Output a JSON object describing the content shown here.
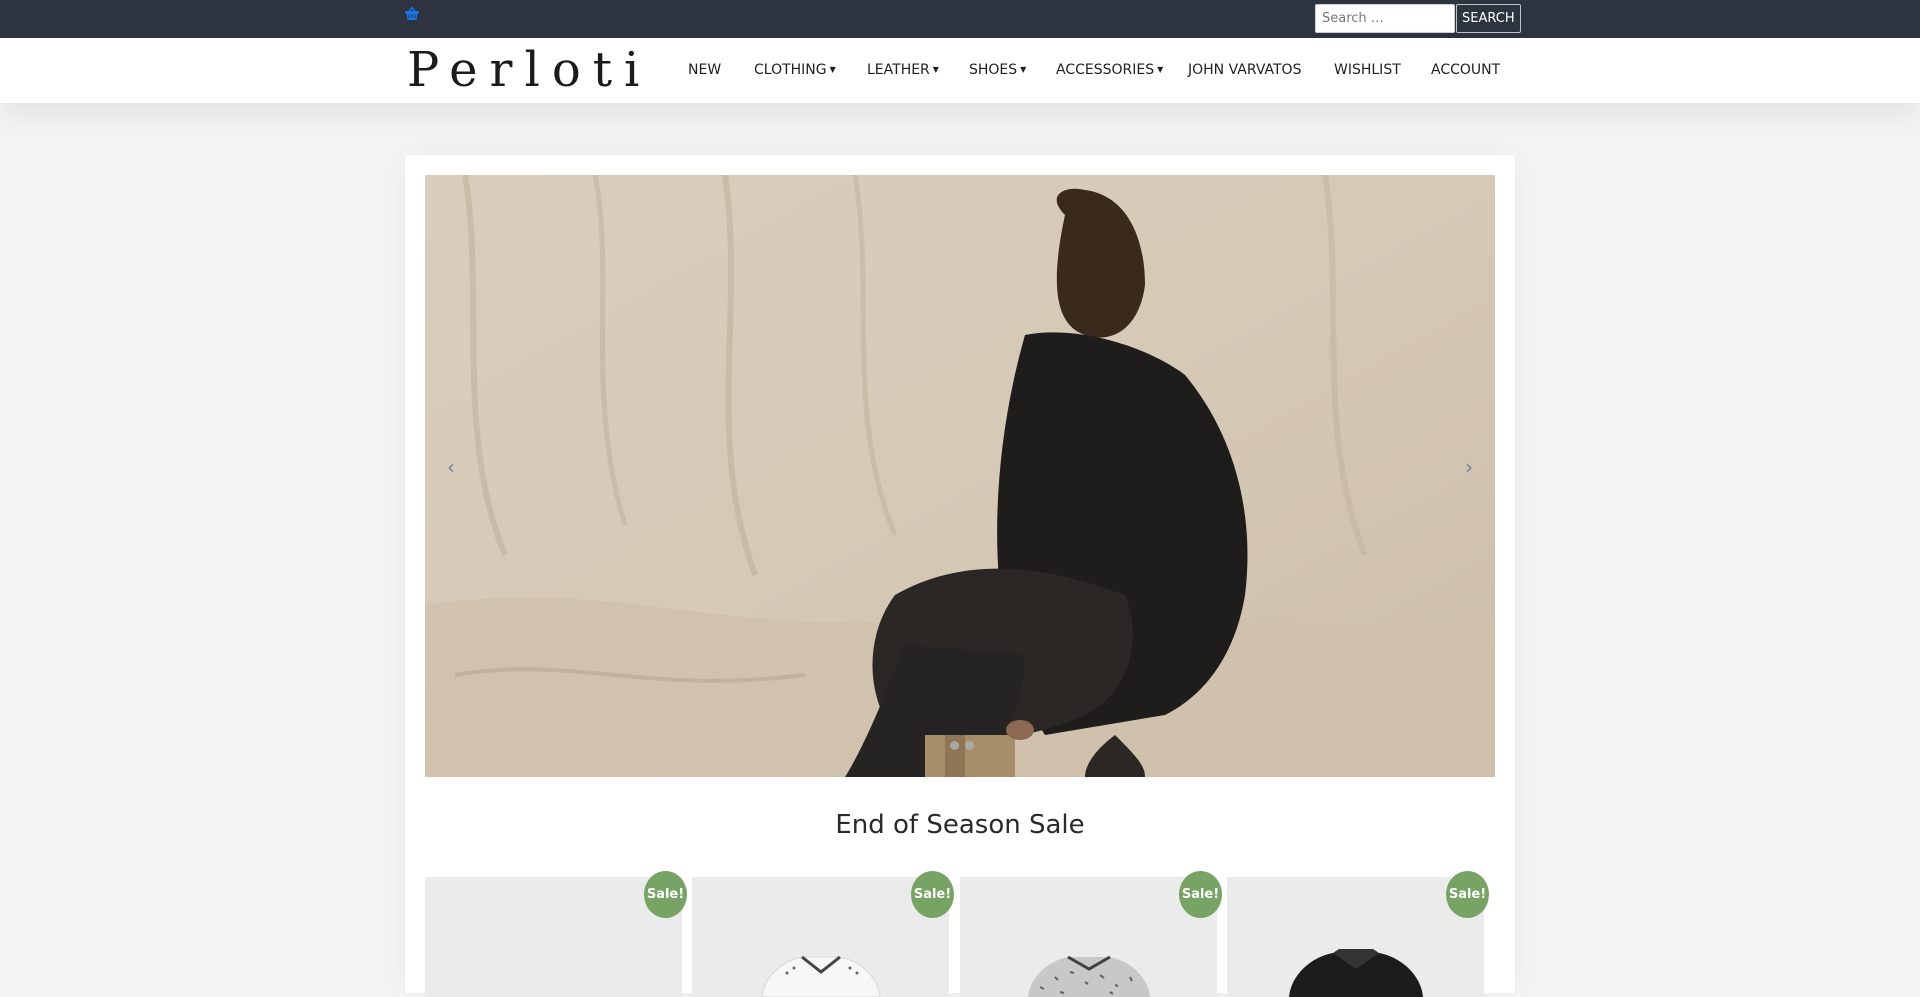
{
  "topbar": {
    "cart_icon": "basket-icon",
    "search": {
      "placeholder": "Search …",
      "button_label": "SEARCH"
    }
  },
  "header": {
    "logo_text": "Perloti",
    "nav": [
      {
        "label": "NEW",
        "has_dropdown": false
      },
      {
        "label": "CLOTHING",
        "has_dropdown": true
      },
      {
        "label": "LEATHER",
        "has_dropdown": true
      },
      {
        "label": "SHOES",
        "has_dropdown": true
      },
      {
        "label": "ACCESSORIES",
        "has_dropdown": true
      },
      {
        "label": "JOHN VARVATOS",
        "has_dropdown": false
      },
      {
        "label": "WISHLIST",
        "has_dropdown": false
      },
      {
        "label": "ACCOUNT",
        "has_dropdown": false
      }
    ]
  },
  "slider": {
    "prev_icon": "chevron-left-icon",
    "next_icon": "chevron-right-icon",
    "prev_glyph": "‹",
    "next_glyph": "›",
    "slide_count": 2
  },
  "main": {
    "section_title": "End of Season Sale",
    "products": [
      {
        "badge": "Sale!"
      },
      {
        "badge": "Sale!"
      },
      {
        "badge": "Sale!"
      },
      {
        "badge": "Sale!"
      }
    ]
  },
  "colors": {
    "topbar": "#2e343f",
    "accent_blue": "#1a73e8",
    "sale_badge": "#77a464"
  }
}
